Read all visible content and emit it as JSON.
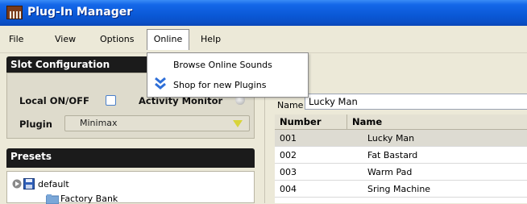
{
  "window": {
    "title": "Plug-In Manager"
  },
  "menubar": {
    "items": [
      "File",
      "View",
      "Options",
      "Online",
      "Help"
    ]
  },
  "online_menu": {
    "items": [
      "Browse Online Sounds",
      "Shop for new Plugins"
    ]
  },
  "slot_config": {
    "header": "Slot Configuration",
    "local_label": "Local ON/OFF",
    "activity_label": "Activity Monitor",
    "plugin_label": "Plugin",
    "plugin_value": "Minimax"
  },
  "presets": {
    "header": "Presets",
    "tree": [
      "default",
      "Factory Bank"
    ]
  },
  "patches": {
    "name_label": "Name",
    "name_value": "Lucky Man",
    "columns": [
      "Number",
      "Name"
    ],
    "rows": [
      {
        "number": "001",
        "name": "Lucky Man"
      },
      {
        "number": "002",
        "name": "Fat Bastard"
      },
      {
        "number": "003",
        "name": "Warm Pad"
      },
      {
        "number": "004",
        "name": "Sring Machine"
      }
    ]
  },
  "colors": {
    "titlebar": "#0a58d6",
    "section_header": "#1b1b1b",
    "combo_arrow": "#d8d43a"
  }
}
